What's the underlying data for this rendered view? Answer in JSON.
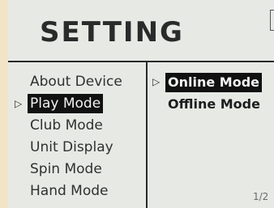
{
  "screen": {
    "title": "SETTING",
    "page_indicator": "1/2"
  },
  "menu": {
    "cursor_glyph": "▷",
    "items": [
      {
        "label": "About Device",
        "selected": false
      },
      {
        "label": "Play Mode",
        "selected": true
      },
      {
        "label": "Club Mode",
        "selected": false
      },
      {
        "label": "Unit Display",
        "selected": false
      },
      {
        "label": "Spin Mode",
        "selected": false
      },
      {
        "label": "Hand Mode",
        "selected": false
      }
    ]
  },
  "submenu": {
    "items": [
      {
        "label": "Online Mode",
        "selected": true
      },
      {
        "label": "Offline Mode",
        "selected": false
      }
    ]
  },
  "colors": {
    "screen_bg": "#e7e9e5",
    "bezel": "#f2e4c6",
    "highlight_bg": "#111111",
    "text": "#1d1d1d"
  }
}
